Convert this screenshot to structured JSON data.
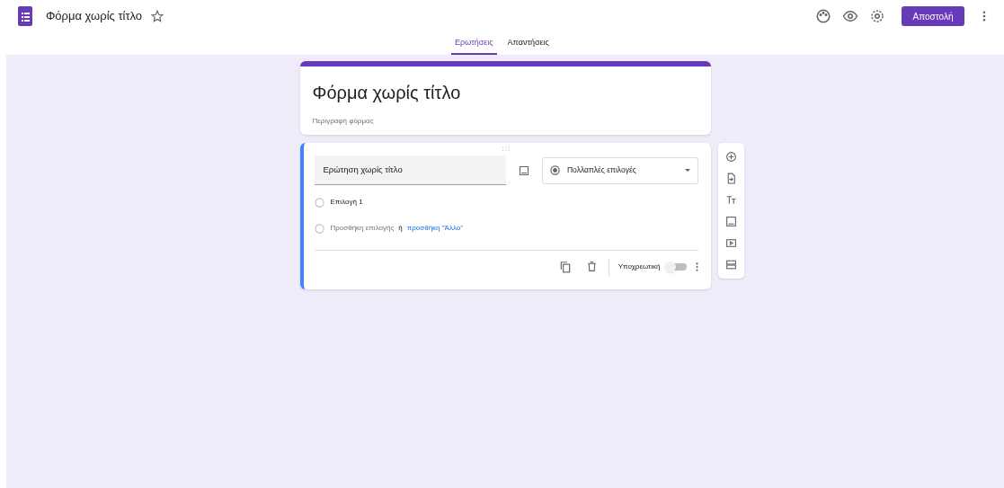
{
  "header": {
    "title": "Φόρμα χωρίς τίτλο",
    "starred": false,
    "send_button": "Αποστολή"
  },
  "tabs": [
    {
      "label": "Ερωτήσεις",
      "selected": true
    },
    {
      "label": "Απαντήσεις",
      "selected": false
    }
  ],
  "form": {
    "title": "Φόρμα χωρίς τίτλο",
    "description": "Περιγραφή φόρμας"
  },
  "question": {
    "title": "Ερώτηση χωρίς τίτλο",
    "type": "Πολλαπλές επιλογές",
    "options": [
      {
        "kind": "option",
        "label": "Επιλογή 1"
      },
      {
        "kind": "add",
        "label": "Προσθήκη επιλογής",
        "separator": "ή",
        "link": "προσθήκη \"Άλλο\""
      }
    ],
    "required_label": "Υποχρεωτική",
    "required": false
  }
}
